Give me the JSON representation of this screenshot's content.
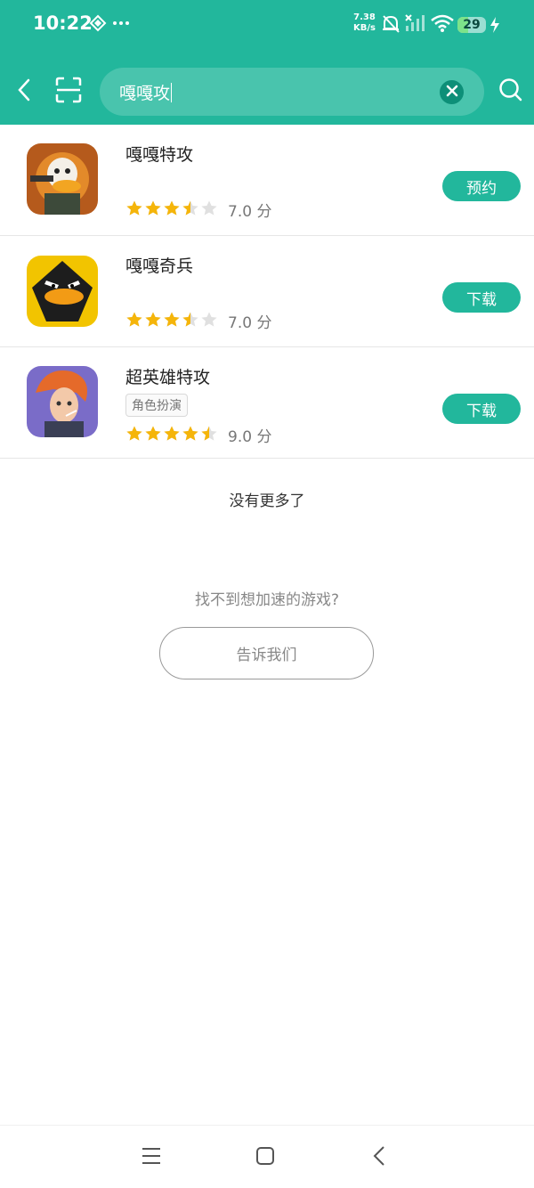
{
  "status_bar": {
    "time": "10:22",
    "net_speed_value": "7.38",
    "net_speed_unit": "KB/s",
    "battery": "29",
    "icons": [
      "diamond-icon",
      "more-dots-icon",
      "mute-bell-icon",
      "signal-icon",
      "wifi-icon",
      "charging-icon"
    ]
  },
  "toolbar": {
    "query": "嘎嘎攻",
    "icons": [
      "back-icon",
      "scan-icon",
      "clear-icon",
      "search-icon"
    ]
  },
  "results": [
    {
      "name": "嘎嘎特攻",
      "tag": "",
      "rating": 3.5,
      "score": "7.0",
      "score_unit": "分",
      "action": "预约",
      "icon": "duck-soldier-icon"
    },
    {
      "name": "嘎嘎奇兵",
      "tag": "",
      "rating": 3.5,
      "score": "7.0",
      "score_unit": "分",
      "action": "下载",
      "icon": "angry-duck-icon"
    },
    {
      "name": "超英雄特攻",
      "tag": "角色扮演",
      "rating": 4.5,
      "score": "9.0",
      "score_unit": "分",
      "action": "下载",
      "icon": "hero-girl-icon"
    }
  ],
  "footer": {
    "no_more": "没有更多了",
    "cant_find": "找不到想加速的游戏?",
    "tell_us": "告诉我们"
  },
  "nav": {
    "icons": [
      "menu-icon",
      "home-icon",
      "back-nav-icon"
    ]
  },
  "colors": {
    "accent": "#22b79c",
    "star": "#f5b50a",
    "star_empty": "#e0e0e0"
  }
}
